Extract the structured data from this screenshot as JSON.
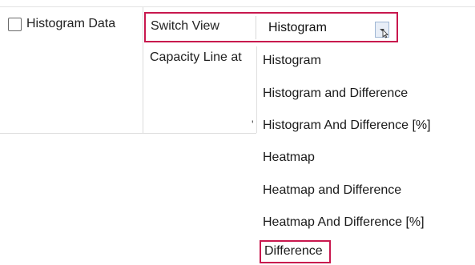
{
  "checkbox": {
    "label": "Histogram Data",
    "checked": false
  },
  "switch_view": {
    "label": "Switch View",
    "selected": "Histogram",
    "highlight_color": "#c8184e"
  },
  "capacity": {
    "label": "Capacity Line at"
  },
  "fragment": "'",
  "dropdown": {
    "options": [
      "Histogram",
      "Histogram and Difference",
      "Histogram And Difference [%]",
      "Heatmap",
      "Heatmap and Difference",
      "Heatmap And Difference [%]",
      "Difference"
    ],
    "highlighted_option": "Difference"
  },
  "icons": {
    "combo_arrow": "chevron-down-icon",
    "cursor": "mouse-pointer-icon"
  }
}
